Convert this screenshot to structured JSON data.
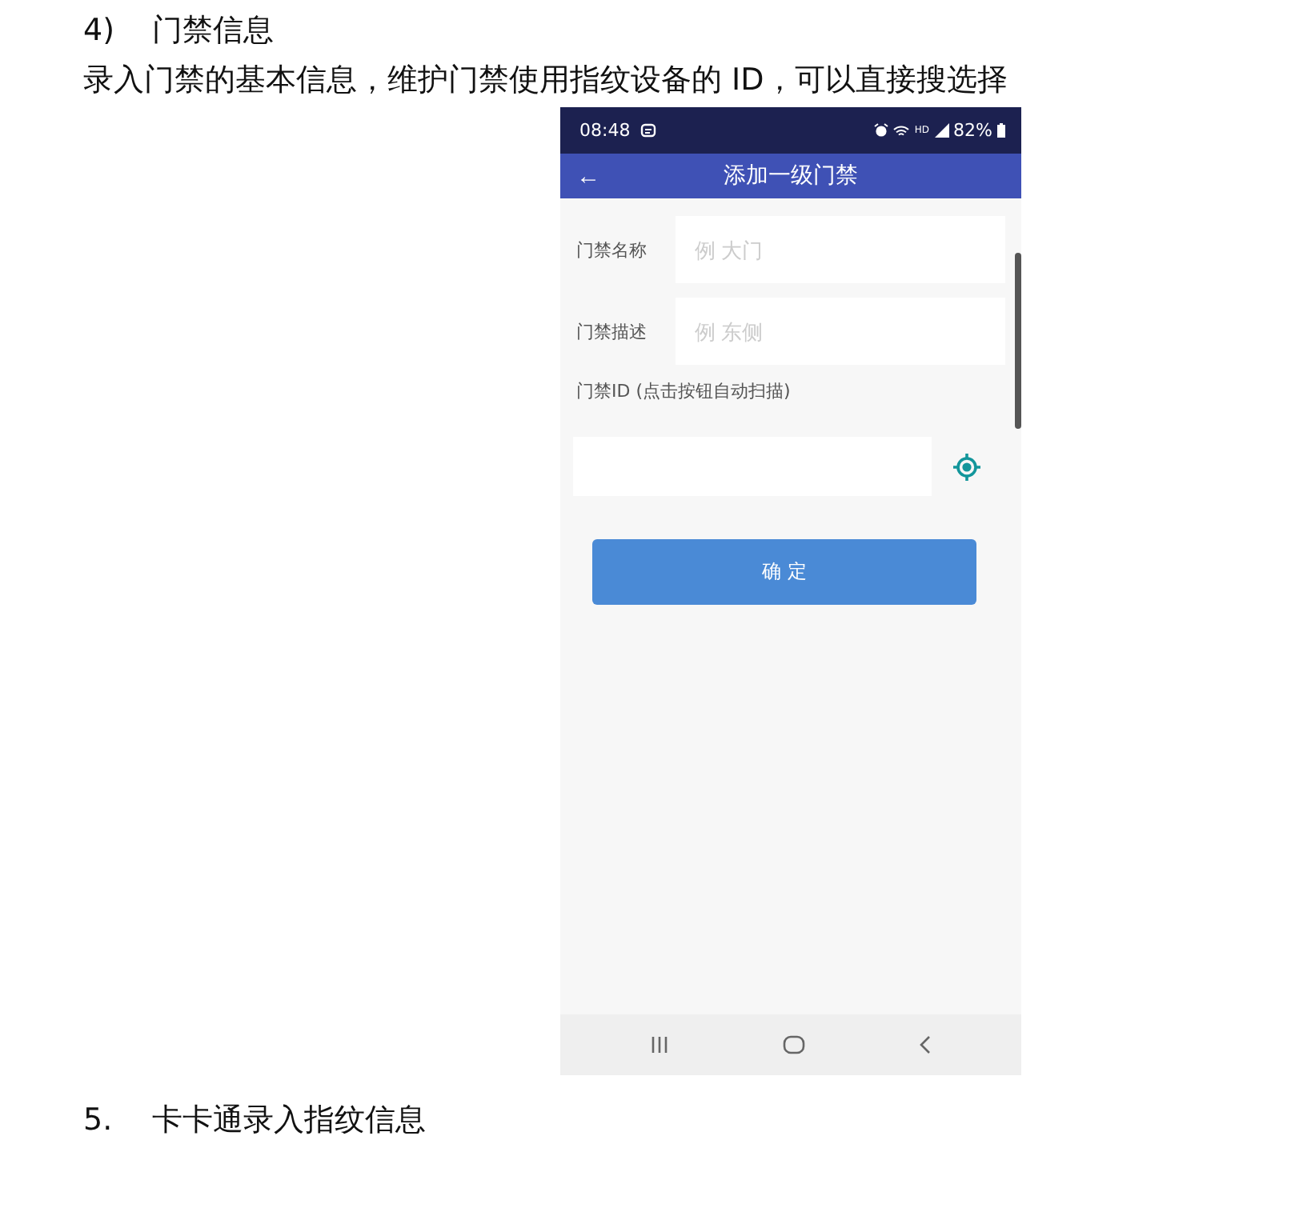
{
  "section_heading": {
    "number": "4)",
    "title": "门禁信息"
  },
  "description": "录入门禁的基本信息，维护门禁使用指纹设备的 ID，可以直接搜选择",
  "phone": {
    "status_bar": {
      "time": "08:48",
      "network": "HD",
      "battery": "82%"
    },
    "app_bar": {
      "back": "←",
      "title": "添加一级门禁"
    },
    "fields": [
      {
        "label": "门禁名称",
        "placeholder": "例 大门"
      },
      {
        "label": "门禁描述",
        "placeholder": "例 东侧"
      }
    ],
    "id_field": {
      "label": "门禁ID (点击按钮自动扫描)"
    },
    "confirm_button": "确 定"
  },
  "next_heading": {
    "number": "5.",
    "title": "卡卡通录入指纹信息"
  }
}
